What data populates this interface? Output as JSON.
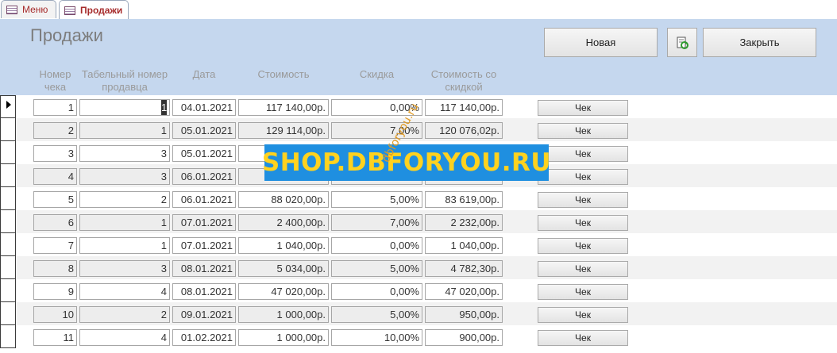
{
  "tabs": [
    {
      "label": "Меню",
      "active": false
    },
    {
      "label": "Продажи",
      "active": true
    }
  ],
  "form": {
    "title": "Продажи",
    "buttons": {
      "new": "Новая",
      "close": "Закрыть",
      "refresh_icon": "refresh-icon"
    },
    "columns": {
      "receipt_no": "Номер чека",
      "seller_no": "Табельный номер продавца",
      "date": "Дата",
      "cost": "Стоимость",
      "discount": "Скидка",
      "total": "Стоимость со скидкой"
    },
    "row_button_label": "Чек",
    "rows": [
      {
        "receipt": "1",
        "seller": "1",
        "date": "04.01.2021",
        "cost": "117 140,00р.",
        "discount": "0,00%",
        "total": "117 140,00р."
      },
      {
        "receipt": "2",
        "seller": "1",
        "date": "05.01.2021",
        "cost": "129 114,00р.",
        "discount": "7,00%",
        "total": "120 076,02р."
      },
      {
        "receipt": "3",
        "seller": "3",
        "date": "05.01.2021",
        "cost": "",
        "discount": "",
        "total": ""
      },
      {
        "receipt": "4",
        "seller": "3",
        "date": "06.01.2021",
        "cost": "",
        "discount": "",
        "total": ""
      },
      {
        "receipt": "5",
        "seller": "2",
        "date": "06.01.2021",
        "cost": "88 020,00р.",
        "discount": "5,00%",
        "total": "83 619,00р."
      },
      {
        "receipt": "6",
        "seller": "1",
        "date": "07.01.2021",
        "cost": "2 400,00р.",
        "discount": "7,00%",
        "total": "2 232,00р."
      },
      {
        "receipt": "7",
        "seller": "1",
        "date": "07.01.2021",
        "cost": "1 040,00р.",
        "discount": "0,00%",
        "total": "1 040,00р."
      },
      {
        "receipt": "8",
        "seller": "3",
        "date": "08.01.2021",
        "cost": "5 034,00р.",
        "discount": "5,00%",
        "total": "4 782,30р."
      },
      {
        "receipt": "9",
        "seller": "4",
        "date": "08.01.2021",
        "cost": "47 020,00р.",
        "discount": "0,00%",
        "total": "47 020,00р."
      },
      {
        "receipt": "10",
        "seller": "2",
        "date": "09.01.2021",
        "cost": "1 000,00р.",
        "discount": "5,00%",
        "total": "950,00р."
      },
      {
        "receipt": "11",
        "seller": "4",
        "date": "01.02.2021",
        "cost": "1 000,00р.",
        "discount": "10,00%",
        "total": "900,00р."
      }
    ]
  },
  "watermark": {
    "main": "SHOP.DBFORYOU.RU",
    "small": "dbforyou.ru"
  },
  "colors": {
    "header_bg": "#c5d7ee",
    "tab_text": "#a62b2b",
    "watermark_bg": "#1f8fe0",
    "watermark_text": "#ffd21f"
  }
}
